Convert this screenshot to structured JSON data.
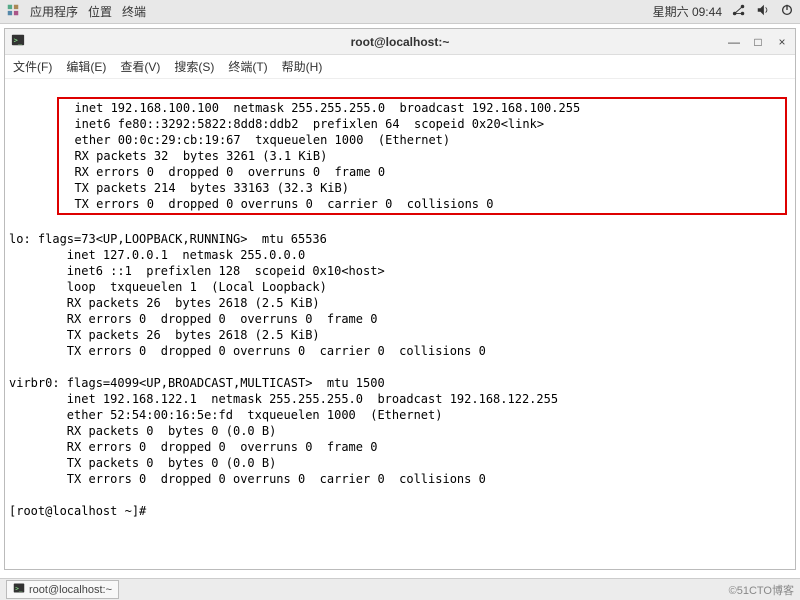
{
  "system_bar": {
    "apps": "应用程序",
    "places": "位置",
    "terminal": "终端",
    "date": "星期六 09:44"
  },
  "window": {
    "title": "root@localhost:~",
    "controls": {
      "min": "—",
      "max": "□",
      "close": "×"
    }
  },
  "menubar": {
    "file": "文件(F)",
    "edit": "编辑(E)",
    "view": "查看(V)",
    "search": "搜索(S)",
    "terminal": "终端(T)",
    "help": "帮助(H)"
  },
  "terminal": {
    "redbox": [
      "  inet 192.168.100.100  netmask 255.255.255.0  broadcast 192.168.100.255",
      "  inet6 fe80::3292:5822:8dd8:ddb2  prefixlen 64  scopeid 0x20<link>",
      "  ether 00:0c:29:cb:19:67  txqueuelen 1000  (Ethernet)",
      "  RX packets 32  bytes 3261 (3.1 KiB)",
      "  RX errors 0  dropped 0  overruns 0  frame 0",
      "  TX packets 214  bytes 33163 (32.3 KiB)",
      "  TX errors 0  dropped 0 overruns 0  carrier 0  collisions 0"
    ],
    "body": [
      "",
      "lo: flags=73<UP,LOOPBACK,RUNNING>  mtu 65536",
      "        inet 127.0.0.1  netmask 255.0.0.0",
      "        inet6 ::1  prefixlen 128  scopeid 0x10<host>",
      "        loop  txqueuelen 1  (Local Loopback)",
      "        RX packets 26  bytes 2618 (2.5 KiB)",
      "        RX errors 0  dropped 0  overruns 0  frame 0",
      "        TX packets 26  bytes 2618 (2.5 KiB)",
      "        TX errors 0  dropped 0 overruns 0  carrier 0  collisions 0",
      "",
      "virbr0: flags=4099<UP,BROADCAST,MULTICAST>  mtu 1500",
      "        inet 192.168.122.1  netmask 255.255.255.0  broadcast 192.168.122.255",
      "        ether 52:54:00:16:5e:fd  txqueuelen 1000  (Ethernet)",
      "        RX packets 0  bytes 0 (0.0 B)",
      "        RX errors 0  dropped 0  overruns 0  frame 0",
      "        TX packets 0  bytes 0 (0.0 B)",
      "        TX errors 0  dropped 0 overruns 0  carrier 0  collisions 0",
      "",
      "[root@localhost ~]# "
    ]
  },
  "taskbar": {
    "item": "root@localhost:~",
    "watermark": "©51CTO博客"
  }
}
